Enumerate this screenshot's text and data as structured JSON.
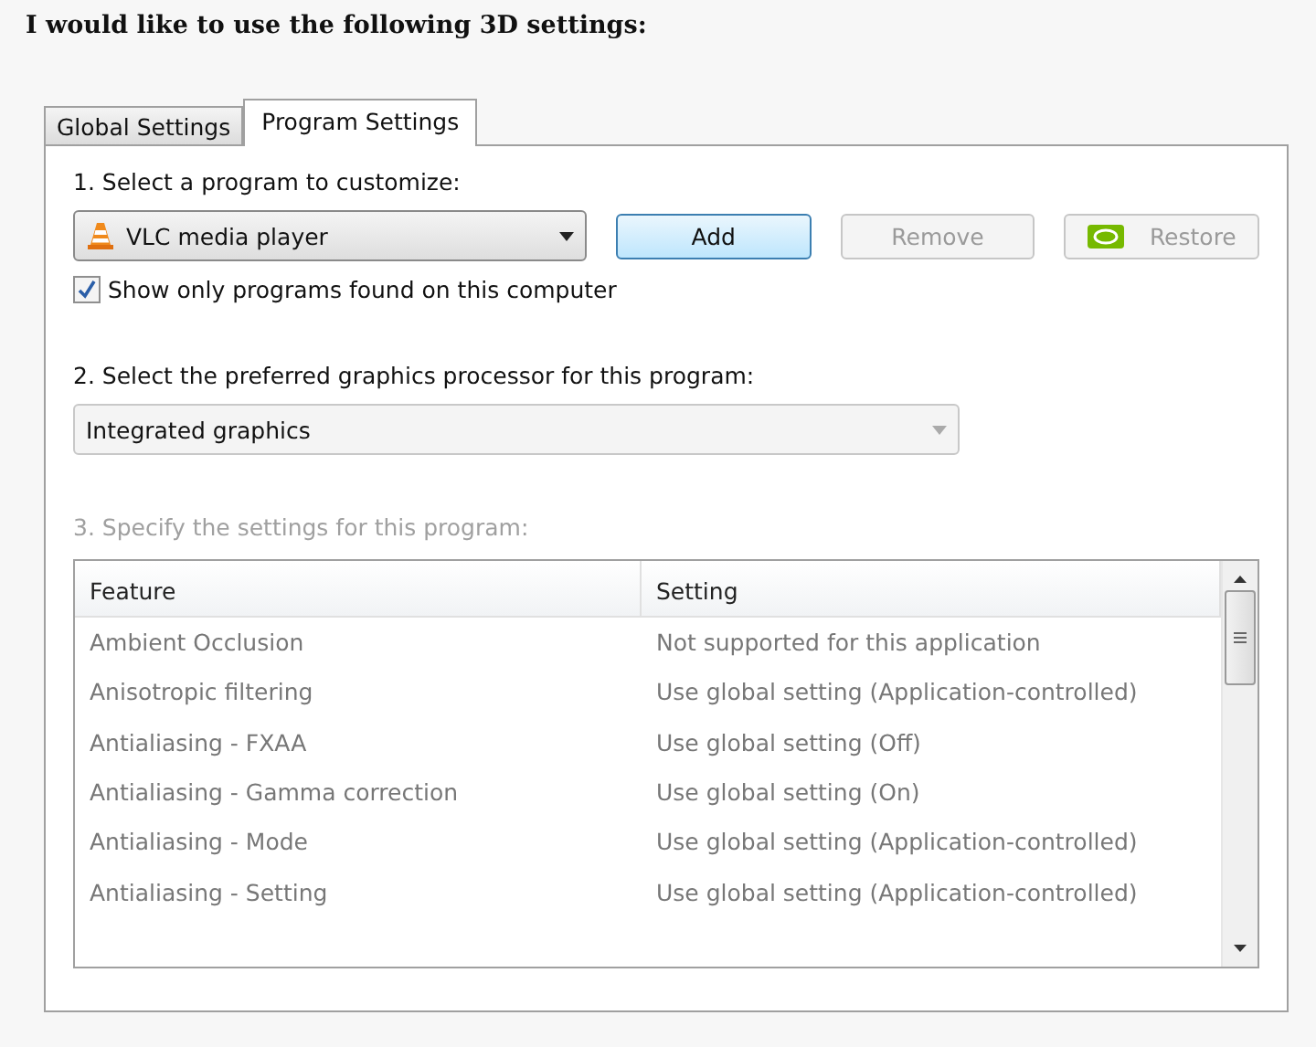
{
  "heading": "I would like to use the following 3D settings:",
  "tabs": [
    {
      "label": "Global Settings",
      "selected": false
    },
    {
      "label": "Program Settings",
      "selected": true
    }
  ],
  "program_section": {
    "label": "1. Select a program to customize:",
    "program": "VLC media player",
    "buttons": [
      {
        "label": "Add",
        "disabled": false,
        "icon": false
      },
      {
        "label": "Remove",
        "disabled": true,
        "icon": false
      },
      {
        "label": "Restore",
        "disabled": true,
        "icon": true
      }
    ],
    "show_only_found": {
      "label": "Show only programs found on this computer",
      "checked": true
    }
  },
  "gpu_section": {
    "label": "2. Select the preferred graphics processor for this program:",
    "value": "Integrated graphics",
    "disabled": true
  },
  "settings_section": {
    "label": "3. Specify the settings for this program:",
    "disabled": true,
    "columns": [
      "Feature",
      "Setting"
    ],
    "rows": [
      {
        "feature": "Ambient Occlusion",
        "setting": "Not supported for this application"
      },
      {
        "feature": "Anisotropic filtering",
        "setting": "Use global setting (Application-controlled)"
      },
      {
        "feature": "Antialiasing - FXAA",
        "setting": "Use global setting (Off)"
      },
      {
        "feature": "Antialiasing - Gamma correction",
        "setting": "Use global setting (On)"
      },
      {
        "feature": "Antialiasing - Mode",
        "setting": "Use global setting (Application-controlled)"
      },
      {
        "feature": "Antialiasing - Setting",
        "setting": "Use global setting (Application-controlled)"
      }
    ]
  }
}
